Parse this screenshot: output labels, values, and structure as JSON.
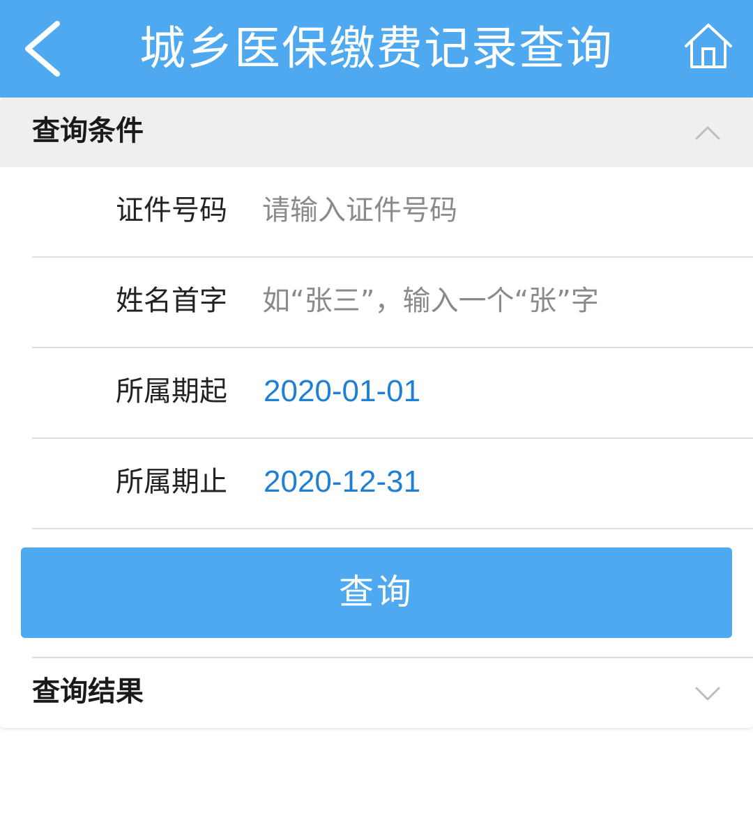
{
  "header": {
    "title": "城乡医保缴费记录查询",
    "back_icon": "chevron-left-icon",
    "home_icon": "home-icon",
    "color": "#4ea9f0"
  },
  "conditions": {
    "title": "查询条件",
    "expanded": true,
    "fields": [
      {
        "label": "证件号码",
        "placeholder": "请输入证件号码",
        "value": ""
      },
      {
        "label": "姓名首字",
        "placeholder": "如“张三”，输入一个“张”字",
        "value": ""
      },
      {
        "label": "所属期起",
        "value": "2020-01-01"
      },
      {
        "label": "所属期止",
        "value": "2020-12-31"
      }
    ]
  },
  "query_button": {
    "label": "查询"
  },
  "results": {
    "title": "查询结果",
    "expanded": false
  },
  "colors": {
    "accent": "#4ea9f0",
    "date_value": "#1f7fd4"
  }
}
